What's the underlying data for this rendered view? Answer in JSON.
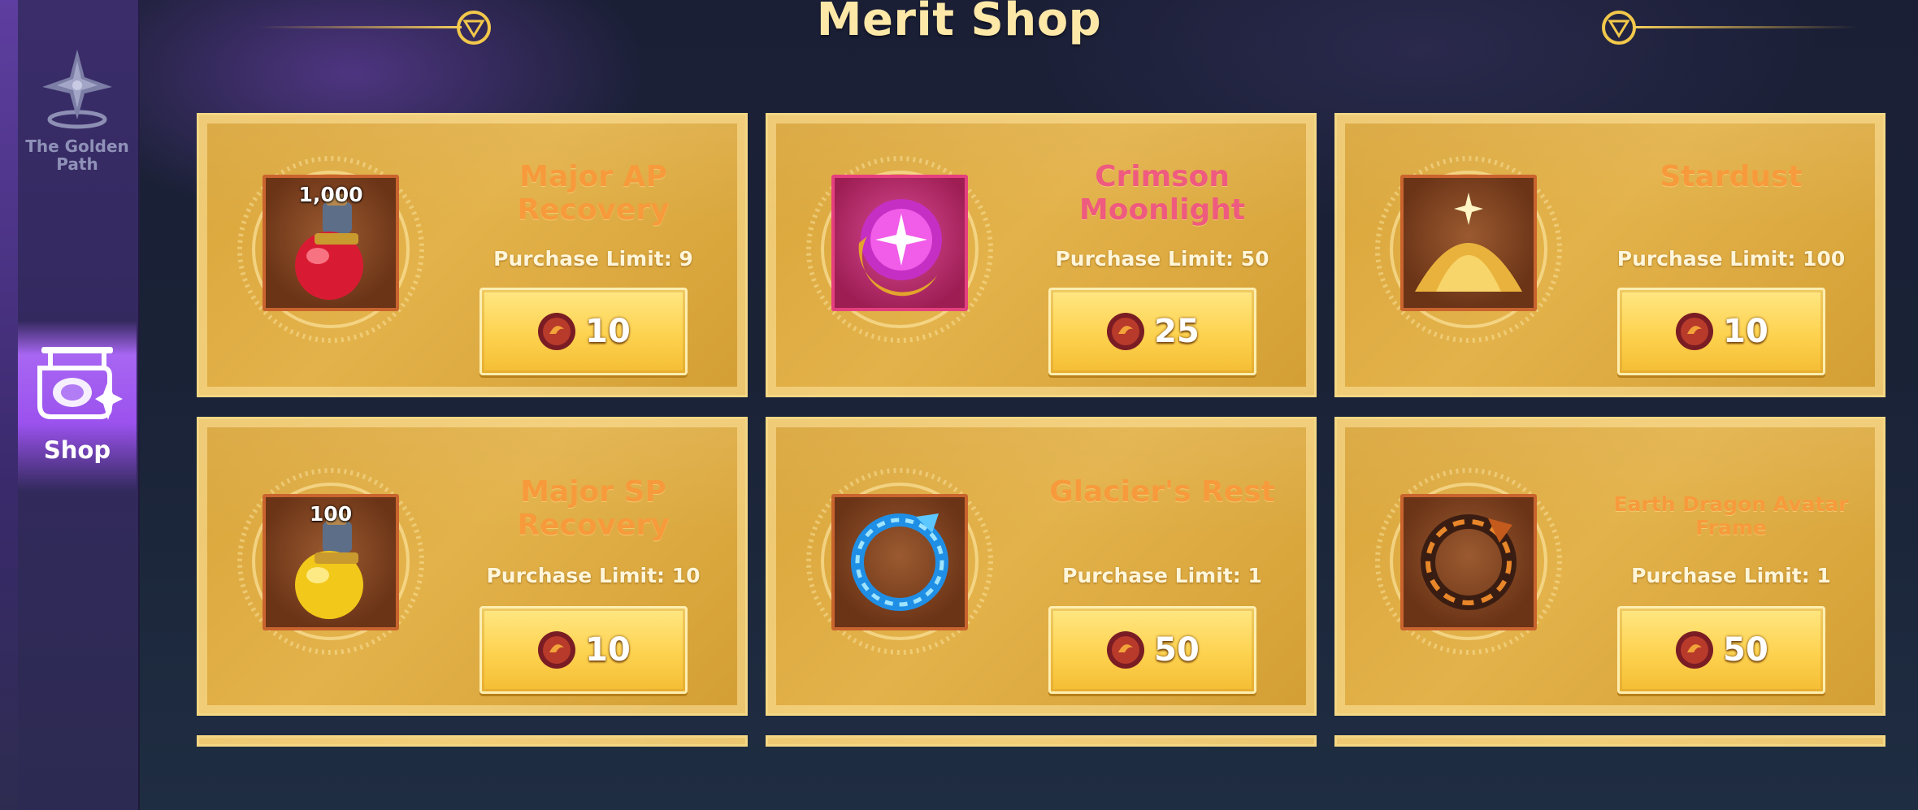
{
  "header": {
    "title": "Merit Shop"
  },
  "sidebar": {
    "items": [
      {
        "label": "The Golden Path",
        "icon": "golden-path-emblem-icon",
        "active": false
      },
      {
        "label": "Shop",
        "icon": "shop-icon",
        "active": true
      }
    ]
  },
  "currency": {
    "icon": "merit-coin-icon"
  },
  "shop_items": [
    {
      "name": "Major AP Recovery",
      "quantity": "1,000",
      "limit_label": "Purchase Limit: 9",
      "price": "10",
      "icon": "red-potion-icon"
    },
    {
      "name": "Crimson Moonlight",
      "quantity": "",
      "limit_label": "Purchase Limit: 50",
      "price": "25",
      "icon": "crescent-moon-orb-icon"
    },
    {
      "name": "Stardust",
      "quantity": "",
      "limit_label": "Purchase Limit: 100",
      "price": "10",
      "icon": "stardust-pile-icon"
    },
    {
      "name": "Major SP Recovery",
      "quantity": "100",
      "limit_label": "Purchase Limit: 10",
      "price": "10",
      "icon": "yellow-potion-icon"
    },
    {
      "name": "Glacier's Rest",
      "quantity": "",
      "limit_label": "Purchase Limit: 1",
      "price": "50",
      "icon": "ice-ring-frame-icon"
    },
    {
      "name": "Earth Dragon Avatar Frame",
      "quantity": "",
      "limit_label": "Purchase Limit: 1",
      "price": "50",
      "icon": "earth-dragon-frame-icon"
    }
  ],
  "colors": {
    "accent": "#f79a3c",
    "title": "#fde8a8",
    "card": "#e0ad42",
    "highlight": "#a866f2"
  }
}
